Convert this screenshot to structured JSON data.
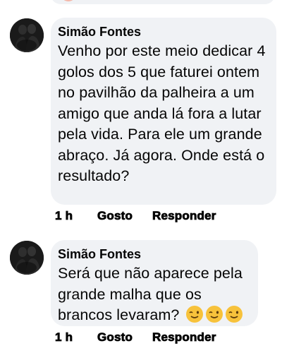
{
  "comments": [
    {
      "author": "Simão Fontes",
      "text": "Venho por este meio dedicar 4 golos dos 5 que faturei ontem no pavilhão da palheira a um amigo que anda lá fora a lutar pela vida. Para ele um grande abraço. Já agora. Onde está o resultado?",
      "time": "1 h",
      "like_label": "Gosto",
      "reply_label": "Responder",
      "avatar_icon": "profile-photo"
    },
    {
      "author": "Simão Fontes",
      "text": "Será que não aparece pela grande malha que os brancos levaram?",
      "emojis": [
        "winking-face-emoji",
        "winking-face-emoji",
        "winking-face-emoji"
      ],
      "time": "1 h",
      "like_label": "Gosto",
      "reply_label": "Responder",
      "avatar_icon": "profile-photo"
    }
  ],
  "colors": {
    "bubble": "#f0f2f5",
    "text": "#050505",
    "emoji": "#f7c23b"
  }
}
